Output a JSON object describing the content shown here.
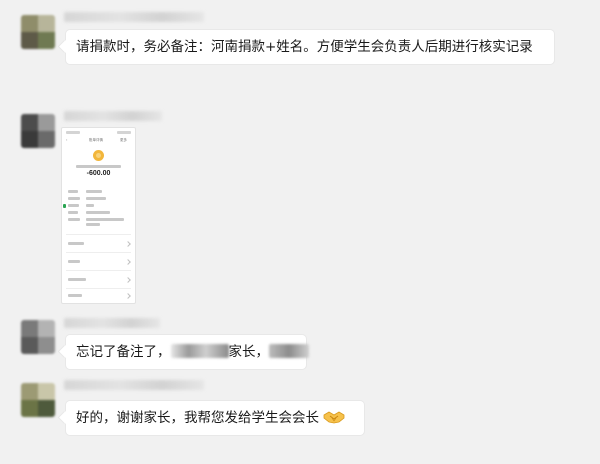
{
  "messages": [
    {
      "type": "text",
      "text": "请捐款时，务必备注：河南捐款+姓名。方便学生会负责人后期进行核实记录"
    },
    {
      "type": "image",
      "image": {
        "header_left": "‹",
        "header_title": "账单详情",
        "header_right": "更多",
        "amount": "-600.00"
      }
    },
    {
      "type": "text",
      "parts": [
        "忘记了备注了，",
        "家长，"
      ]
    },
    {
      "type": "text",
      "text": "好的，谢谢家长，我帮您发给学生会会长",
      "emoji": "handshake-emoji"
    }
  ],
  "colors": {
    "background": "#f1f1f1",
    "bubble": "#ffffff",
    "text": "#1a1a1a",
    "coin": "#f2b63b",
    "status_green": "#2aa552"
  }
}
